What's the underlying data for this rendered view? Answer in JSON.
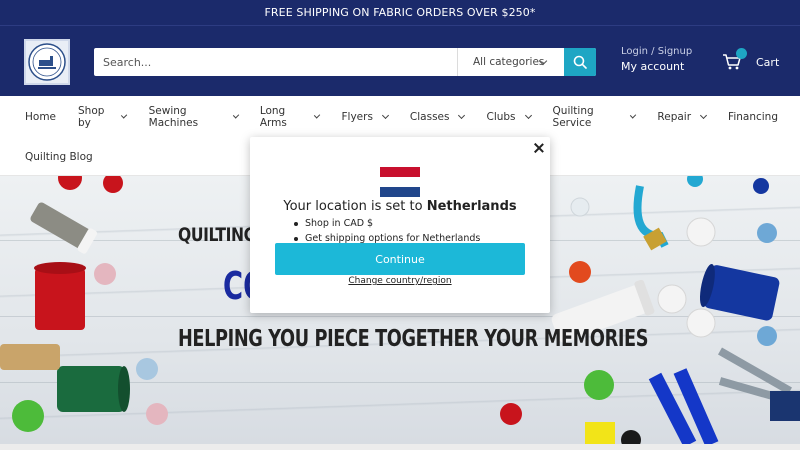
{
  "announcement": "FREE SHIPPING ON FABRIC ORDERS OVER $250*",
  "header": {
    "logo": {
      "text_top": "COTTAGE",
      "text_bottom": "QUILTING"
    },
    "search": {
      "placeholder": "Search...",
      "category": "All categories"
    },
    "account": {
      "line1": "Login / Signup",
      "line2": "My account"
    },
    "cart": {
      "label": "Cart"
    }
  },
  "nav": {
    "row1": [
      {
        "label": "Home",
        "dropdown": false
      },
      {
        "label": "Shop by",
        "dropdown": true
      },
      {
        "label": "Sewing Machines",
        "dropdown": true
      },
      {
        "label": "Long Arms",
        "dropdown": true
      },
      {
        "label": "Flyers",
        "dropdown": true
      },
      {
        "label": "Classes",
        "dropdown": true
      },
      {
        "label": "Clubs",
        "dropdown": true
      },
      {
        "label": "Quilting Service",
        "dropdown": true
      },
      {
        "label": "Repair",
        "dropdown": true
      },
      {
        "label": "Financing",
        "dropdown": false
      }
    ],
    "row2": [
      {
        "label": "Quilting Blog",
        "dropdown": false
      }
    ]
  },
  "hero": {
    "line1": "QUILTING",
    "line2": "CO",
    "line3": "HELPING YOU PIECE TOGETHER YOUR MEMORIES"
  },
  "modal": {
    "title_prefix": "Your location is set to ",
    "country": "Netherlands",
    "bullets": [
      "Shop in CAD $",
      "Get shipping options for Netherlands"
    ],
    "continue_label": "Continue",
    "change_label": "Change country/region",
    "flag_colors": [
      "#c8102e",
      "#ffffff",
      "#21468b"
    ]
  },
  "colors": {
    "brand_navy": "#1b2a6b",
    "accent_teal": "#1ea6c4",
    "button_teal": "#1cb8d8"
  }
}
